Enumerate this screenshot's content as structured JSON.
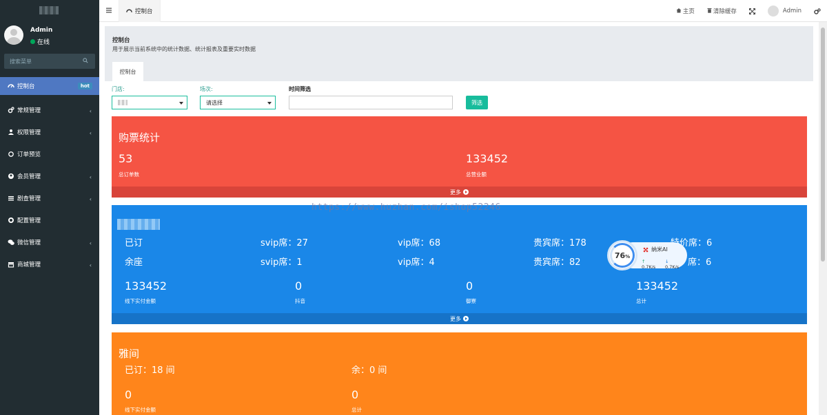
{
  "sidebar": {
    "user": {
      "name": "Admin",
      "status": "在线"
    },
    "search_placeholder": "搜索菜单",
    "items": [
      {
        "label": "控制台",
        "icon": "dashboard-icon",
        "badge": "hot",
        "active": true
      },
      {
        "label": "常规管理",
        "icon": "cogs-icon",
        "has_children": true
      },
      {
        "label": "权限管理",
        "icon": "group-icon",
        "has_children": true
      },
      {
        "label": "订单预览",
        "icon": "circle-icon",
        "has_children": false
      },
      {
        "label": "会员管理",
        "icon": "user-circle-icon",
        "has_children": true
      },
      {
        "label": "剧查管理",
        "icon": "list-icon",
        "has_children": true
      },
      {
        "label": "配置管理",
        "icon": "gear-icon",
        "has_children": false
      },
      {
        "label": "微信管理",
        "icon": "wechat-icon",
        "has_children": true
      },
      {
        "label": "商城管理",
        "icon": "shop-icon",
        "has_children": true
      }
    ]
  },
  "header": {
    "tab_label": "控制台",
    "links": {
      "home": "主页",
      "clear_cache": "清除缓存",
      "user": "Admin"
    }
  },
  "page": {
    "title": "控制台",
    "subtitle": "用于展示当前系统中的统计数据、统计报表及重要实时数据",
    "subtab": "控制台"
  },
  "filters": {
    "store_label": "门店:",
    "session_label": "场次:",
    "session_value": "请选择",
    "time_label": "时间筛选",
    "filter_button": "筛选"
  },
  "ticket_panel": {
    "title": "购票统计",
    "orders_value": "53",
    "orders_label": "总订单数",
    "revenue_value": "133452",
    "revenue_label": "总营业额",
    "more": "更多"
  },
  "seat_panel": {
    "booked_label": "已订",
    "booked": {
      "svip": "svip席：27",
      "vip": "vip席：68",
      "guest": "贵宾席：178",
      "special": "特价席：6"
    },
    "remain_label": "余座",
    "remain": {
      "svip": "svip席：1",
      "vip": "vip席：4",
      "guest": "贵宾席：82",
      "special": "席：6"
    },
    "stats": [
      {
        "value": "133452",
        "label": "线下实付金额"
      },
      {
        "value": "0",
        "label": "抖音"
      },
      {
        "value": "0",
        "label": "御寮"
      },
      {
        "value": "133452",
        "label": "总计"
      }
    ],
    "more": "更多"
  },
  "room_panel": {
    "title": "雅间",
    "booked": "已订：18 间",
    "remain": "余：0 间",
    "stats": [
      {
        "value": "0",
        "label": "线下实付金额"
      },
      {
        "value": "0",
        "label": "总计"
      }
    ]
  },
  "watermark": "https://www.huzhan.com/ishop52246",
  "widget": {
    "percent": "76",
    "percent_unit": "%",
    "name": "纳米AI",
    "up": "0.7K/s",
    "down": "0.7K/s"
  }
}
